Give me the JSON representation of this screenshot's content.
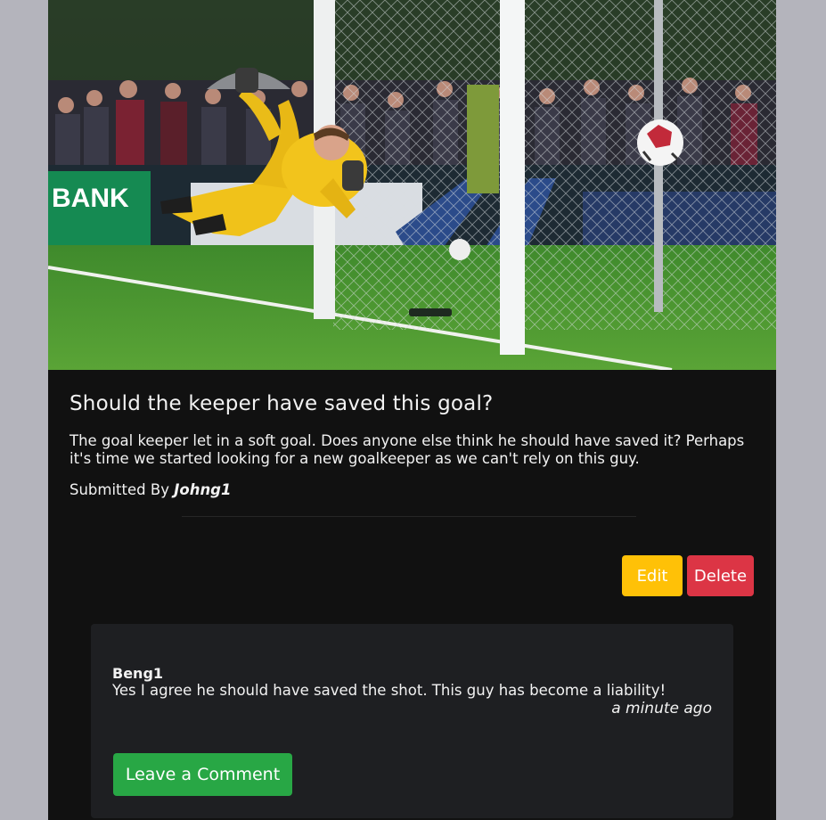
{
  "post": {
    "title": "Should the keeper have saved this goal?",
    "body": "The goal keeper let in a soft goal. Does anyone else think he should have saved it? Perhaps it's time we started looking for a new goalkeeper as we can't rely on this guy.",
    "submitted_prefix": "Submitted By",
    "author": "Johng1",
    "photo_sign_text": "BANK"
  },
  "actions": {
    "edit_label": "Edit",
    "delete_label": "Delete"
  },
  "comments": {
    "items": [
      {
        "author": "Beng1",
        "text": "Yes I agree he should have saved the shot. This guy has become a liability!",
        "time": "a minute ago"
      }
    ],
    "leave_comment_label": "Leave a Comment"
  },
  "colors": {
    "page_background": "#b4b4bc",
    "card_background": "#111111",
    "comment_panel": "#1e1f22",
    "edit_button": "#ffc107",
    "delete_button": "#dc3545",
    "comment_button": "#28a745"
  }
}
